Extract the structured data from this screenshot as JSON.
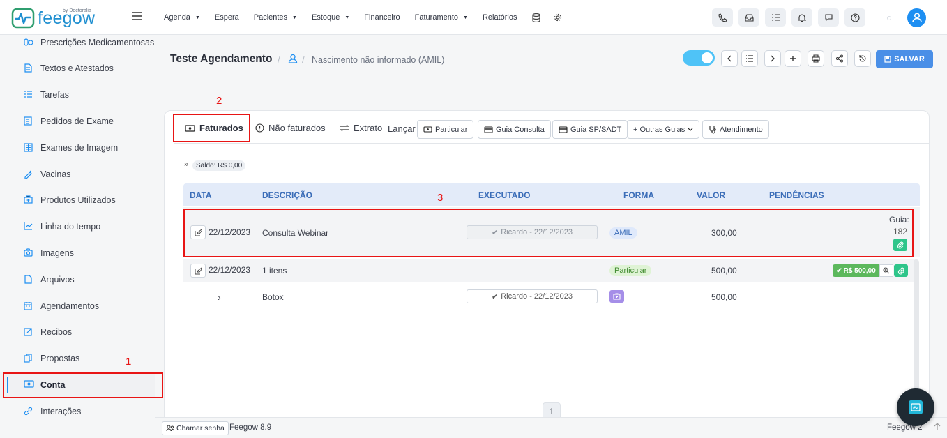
{
  "brand": {
    "logo_text": "feegow",
    "by": "by Doctoralia"
  },
  "topnav": {
    "items": [
      {
        "label": "Agenda",
        "dropdown": true
      },
      {
        "label": "Espera",
        "dropdown": false
      },
      {
        "label": "Pacientes",
        "dropdown": true
      },
      {
        "label": "Estoque",
        "dropdown": true
      },
      {
        "label": "Financeiro",
        "dropdown": false
      },
      {
        "label": "Faturamento",
        "dropdown": true
      },
      {
        "label": "Relatórios",
        "dropdown": false
      }
    ],
    "right_icons": [
      "phone-icon",
      "inbox-icon",
      "checklist-icon",
      "bell-icon",
      "chat-icon",
      "help-icon"
    ]
  },
  "sidebar": {
    "items": [
      {
        "label": "Prescrições Medicamentosas",
        "icon": "pills-icon"
      },
      {
        "label": "Textos e Atestados",
        "icon": "document-icon"
      },
      {
        "label": "Tarefas",
        "icon": "tasks-icon"
      },
      {
        "label": "Pedidos de Exame",
        "icon": "lab-icon"
      },
      {
        "label": "Exames de Imagem",
        "icon": "xray-icon"
      },
      {
        "label": "Vacinas",
        "icon": "syringe-icon"
      },
      {
        "label": "Produtos Utilizados",
        "icon": "box-icon"
      },
      {
        "label": "Linha do tempo",
        "icon": "timeline-icon"
      },
      {
        "label": "Imagens",
        "icon": "camera-icon"
      },
      {
        "label": "Arquivos",
        "icon": "file-icon"
      },
      {
        "label": "Agendamentos",
        "icon": "calendar-icon"
      },
      {
        "label": "Recibos",
        "icon": "receipt-icon"
      },
      {
        "label": "Propostas",
        "icon": "copy-icon"
      },
      {
        "label": "Conta",
        "icon": "money-icon",
        "active": true
      },
      {
        "label": "Interações",
        "icon": "link-icon"
      }
    ]
  },
  "header": {
    "title": "Teste Agendamento",
    "separator": "/",
    "patient_info": "Nascimento não informado (AMIL)",
    "save_label": "SALVAR"
  },
  "tabs": {
    "faturados": "Faturados",
    "nao_faturados": "Não faturados",
    "extrato": "Extrato",
    "lancar": "Lançar",
    "buttons": [
      "Particular",
      "Guia Consulta",
      "Guia SP/SADT",
      "+ Outras Guias",
      "Atendimento"
    ]
  },
  "saldo": {
    "arrow": "»",
    "label": "Saldo: R$ 0,00"
  },
  "table": {
    "headers": [
      "DATA",
      "DESCRIÇÃO",
      "EXECUTADO",
      "FORMA",
      "VALOR",
      "PENDÊNCIAS"
    ],
    "rows": [
      {
        "date": "22/12/2023",
        "description": "Consulta Webinar",
        "executed": "Ricardo - 22/12/2023",
        "forma": "AMIL",
        "valor": "300,00",
        "guia_label": "Guia:",
        "guia_number": "182"
      },
      {
        "date": "22/12/2023",
        "description": "1 itens",
        "executed": "",
        "forma": "Particular",
        "valor": "500,00",
        "paid": "R$ 500,00"
      },
      {
        "date": "",
        "description": "Botox",
        "executed": "Ricardo - 22/12/2023",
        "forma": "",
        "valor": "500,00",
        "expand": "›"
      }
    ]
  },
  "pagination": {
    "current": "1"
  },
  "footer": {
    "chamar": "Chamar senha",
    "version": "Feegow 8.9",
    "brand2": "Feegow 2"
  },
  "annotations": [
    "1",
    "2",
    "3"
  ],
  "colors": {
    "accent": "#1e8ff2",
    "save": "#4a8fe7",
    "annotation": "#e81515",
    "success": "#2ec58a"
  }
}
